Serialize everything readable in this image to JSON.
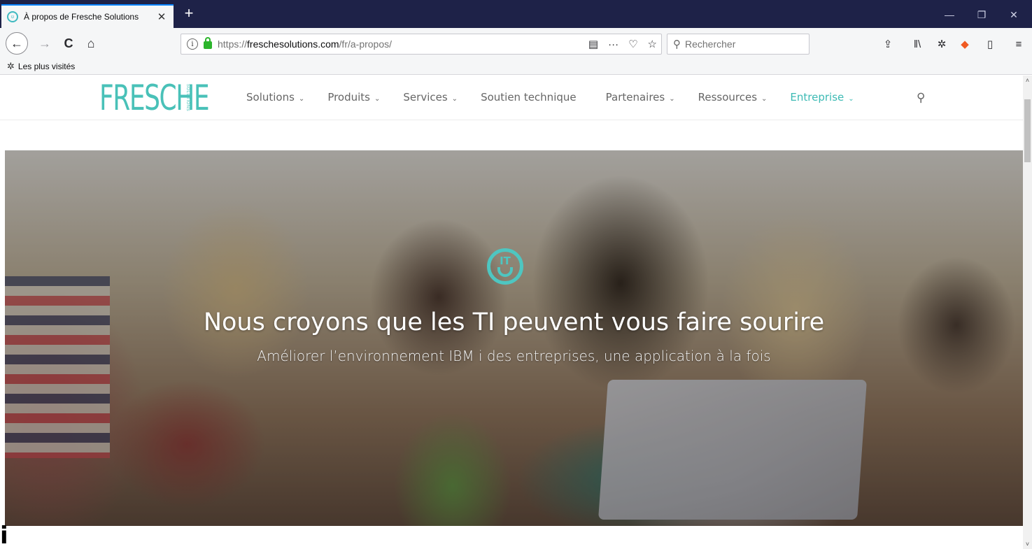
{
  "browser": {
    "tab": {
      "title": "À propos de Fresche Solutions",
      "close": "✕",
      "favicon": "ʊ"
    },
    "new_tab": "+",
    "window_controls": {
      "minimize": "—",
      "restore": "❐",
      "close": "✕"
    },
    "nav": {
      "back": "←",
      "forward": "→",
      "reload": "C",
      "home": "⌂"
    },
    "url": {
      "host_prefix": "https://",
      "host": "freschesolutions.com",
      "path": "/fr/a-propos/",
      "info": "i"
    },
    "url_actions": {
      "reader": "▤",
      "more": "···",
      "pocket": "♡",
      "bookmark": "☆"
    },
    "search": {
      "icon": "⚲",
      "placeholder": "Rechercher"
    },
    "toolbar_icons": [
      "⇪",
      "ǁ\\",
      "✲",
      "◆",
      "▯",
      "≡"
    ],
    "bookmarks": {
      "icon": "✲",
      "label": "Les plus visités"
    }
  },
  "site": {
    "logo": {
      "word": "FRESCHE",
      "tag": "SOLUTIONS"
    },
    "menu": [
      {
        "label": "Solutions",
        "chevron": "⌄"
      },
      {
        "label": "Produits",
        "chevron": "⌄"
      },
      {
        "label": "Services",
        "chevron": "⌄"
      },
      {
        "label": "Soutien technique",
        "chevron": ""
      },
      {
        "label": "Partenaires",
        "chevron": "⌄"
      },
      {
        "label": "Ressources",
        "chevron": "⌄"
      },
      {
        "label": "Entreprise",
        "chevron": "⌄"
      }
    ],
    "search_icon": "⚲",
    "hero": {
      "icon_text": "IT",
      "title": "Nous croyons que les TI peuvent vous faire sourire",
      "subtitle": "Améliorer l’environnement IBM i des entreprises, une application à la fois"
    },
    "stray_glyph": "i"
  },
  "scrollbar": {
    "up": "˄",
    "down": "˅"
  },
  "colors": {
    "titlebar": "#1e2248",
    "brand": "#49c1b8",
    "menu_active": "#3cbab4"
  }
}
